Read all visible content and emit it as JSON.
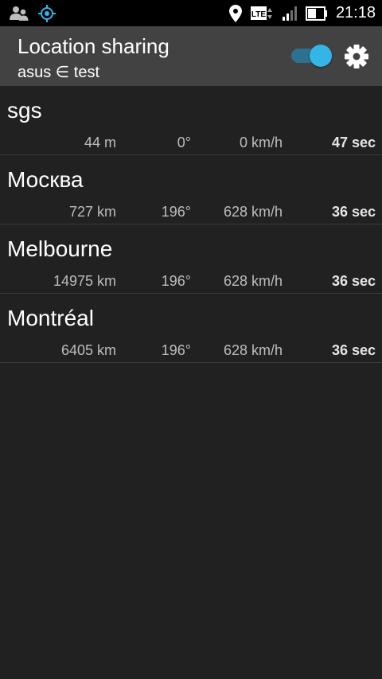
{
  "status_bar": {
    "time": "21:18",
    "left_icons": [
      "people-icon",
      "gps-target-icon"
    ],
    "right_icons": [
      "location-pin-icon",
      "lte-icon",
      "signal-icon",
      "battery-icon"
    ],
    "network_label": "LTE"
  },
  "app_bar": {
    "title": "Location sharing",
    "subtitle": "asus ∈ test",
    "sharing_enabled": true,
    "accent_color": "#33b5e5"
  },
  "rows": [
    {
      "name": "sgs",
      "distance": "44 m",
      "bearing": "0°",
      "speed": "0 km/h",
      "age": "47 sec"
    },
    {
      "name": "Москва",
      "distance": "727 km",
      "bearing": "196°",
      "speed": "628 km/h",
      "age": "36 sec"
    },
    {
      "name": "Melbourne",
      "distance": "14975 km",
      "bearing": "196°",
      "speed": "628 km/h",
      "age": "36 sec"
    },
    {
      "name": "Montréal",
      "distance": "6405 km",
      "bearing": "196°",
      "speed": "628 km/h",
      "age": "36 sec"
    }
  ]
}
